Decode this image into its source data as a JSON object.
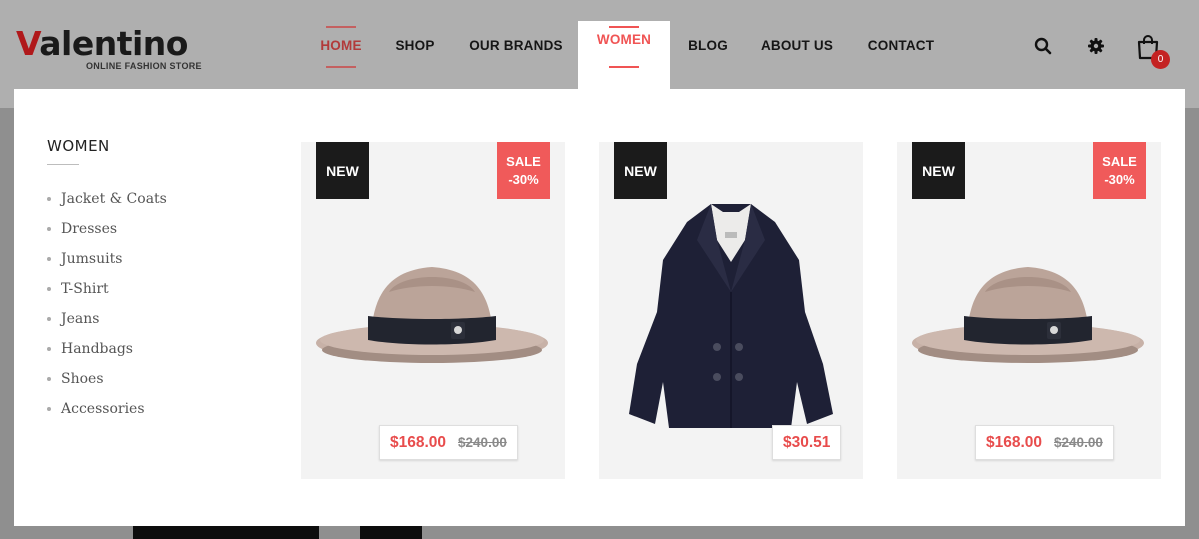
{
  "brand": {
    "name": "Valentino",
    "name_first": "V",
    "name_rest": "alentino",
    "tagline": "ONLINE FASHION STORE"
  },
  "nav": {
    "items": [
      {
        "label": "HOME",
        "active": true
      },
      {
        "label": "SHOP",
        "active": false
      },
      {
        "label": "OUR BRANDS",
        "active": false
      },
      {
        "label": "WOMEN",
        "active": false,
        "open": true
      },
      {
        "label": "BLOG",
        "active": false
      },
      {
        "label": "ABOUT US",
        "active": false
      },
      {
        "label": "CONTACT",
        "active": false
      }
    ]
  },
  "header_icons": {
    "search": "search-icon",
    "settings": "gear-icon",
    "cart": "shopping-bag-icon",
    "cart_count": "0"
  },
  "mega_menu": {
    "title": "WOMEN",
    "categories": [
      "Jacket & Coats",
      "Dresses",
      "Jumsuits",
      "T-Shirt",
      "Jeans",
      "Handbags",
      "Shoes",
      "Accessories"
    ],
    "products": [
      {
        "badge": "NEW",
        "sale_line1": "SALE",
        "sale_line2": "-30%",
        "price": "$168.00",
        "old_price": "$240.00",
        "image": "fedora-hat"
      },
      {
        "badge": "NEW",
        "price": "$30.51",
        "image": "navy-peacoat"
      },
      {
        "badge": "NEW",
        "sale_line1": "SALE",
        "sale_line2": "-30%",
        "price": "$168.00",
        "old_price": "$240.00",
        "image": "fedora-hat"
      }
    ]
  },
  "colors": {
    "accent": "#f05454",
    "sale_badge": "#f05a5a",
    "new_badge": "#1b1b1b",
    "overlay": "#afafaf"
  }
}
